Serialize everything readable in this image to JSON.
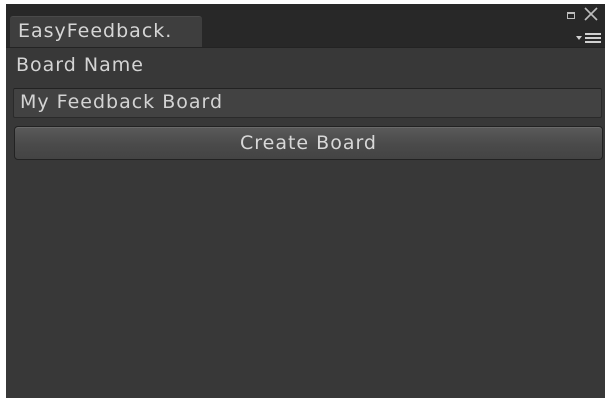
{
  "window": {
    "tab_title": "EasyFeedback.",
    "icons": {
      "maximize": "maximize-icon",
      "close": "close-icon",
      "menu": "context-menu-icon"
    }
  },
  "form": {
    "board_name_label": "Board Name",
    "board_name_value": "My Feedback Board",
    "create_button_label": "Create Board"
  },
  "colors": {
    "panel_background": "#383838",
    "tab_bar_background": "#282828",
    "text": "#d4d4d4"
  }
}
